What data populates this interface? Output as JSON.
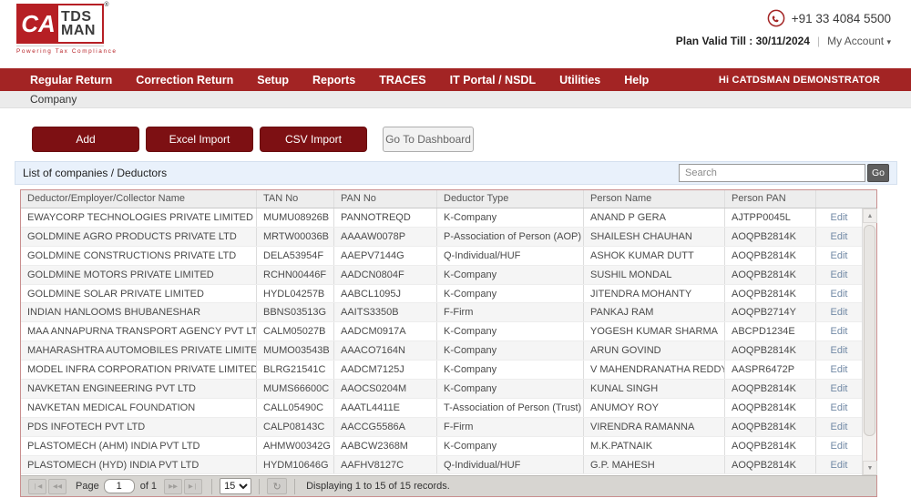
{
  "brand": {
    "ca": "CA",
    "tds": "TDS",
    "man": "MAN",
    "reg": "®",
    "tagline": "Powering Tax Compliance"
  },
  "topbar": {
    "phone": "+91 33 4084 5500",
    "plan_valid": "Plan Valid Till : 30/11/2024",
    "divider": "|",
    "account": "My Account",
    "account_caret": "▾"
  },
  "nav": {
    "items": [
      "Regular Return",
      "Correction Return",
      "Setup",
      "Reports",
      "TRACES",
      "IT Portal / NSDL",
      "Utilities",
      "Help"
    ],
    "greeting": "Hi CATDSMAN DEMONSTRATOR"
  },
  "breadcrumb": {
    "label": "Company"
  },
  "toolbar": {
    "add": "Add",
    "excel": "Excel Import",
    "csv": "CSV Import",
    "dashboard": "Go To Dashboard"
  },
  "panel": {
    "title": "List of companies / Deductors",
    "search_placeholder": "Search",
    "go": "Go"
  },
  "table": {
    "columns": {
      "name": "Deductor/Employer/Collector Name",
      "tan": "TAN No",
      "pan": "PAN No",
      "type": "Deductor Type",
      "person": "Person Name",
      "person_pan": "Person PAN"
    },
    "edit": "Edit",
    "rows": [
      {
        "name": "EWAYCORP TECHNOLOGIES PRIVATE LIMITED",
        "tan": "MUMU08926B",
        "pan": "PANNOTREQD",
        "type": "K-Company",
        "person": "ANAND P GERA",
        "person_pan": "AJTPP0045L"
      },
      {
        "name": "GOLDMINE AGRO PRODUCTS PRIVATE LTD",
        "tan": "MRTW00036B",
        "pan": "AAAAW0078P",
        "type": "P-Association of Person (AOP)",
        "person": "SHAILESH CHAUHAN",
        "person_pan": "AOQPB2814K"
      },
      {
        "name": "GOLDMINE CONSTRUCTIONS PRIVATE LTD",
        "tan": "DELA53954F",
        "pan": "AAEPV7144G",
        "type": "Q-Individual/HUF",
        "person": "ASHOK KUMAR DUTT",
        "person_pan": "AOQPB2814K"
      },
      {
        "name": "GOLDMINE MOTORS PRIVATE LIMITED",
        "tan": "RCHN00446F",
        "pan": "AADCN0804F",
        "type": "K-Company",
        "person": "SUSHIL MONDAL",
        "person_pan": "AOQPB2814K"
      },
      {
        "name": "GOLDMINE SOLAR PRIVATE LIMITED",
        "tan": "HYDL04257B",
        "pan": "AABCL1095J",
        "type": "K-Company",
        "person": "JITENDRA MOHANTY",
        "person_pan": "AOQPB2814K"
      },
      {
        "name": "INDIAN HANLOOMS BHUBANESHAR",
        "tan": "BBNS03513G",
        "pan": "AAITS3350B",
        "type": "F-Firm",
        "person": "PANKAJ RAM",
        "person_pan": "AOQPB2714Y"
      },
      {
        "name": "MAA ANNAPURNA TRANSPORT AGENCY PVT LTD",
        "tan": "CALM05027B",
        "pan": "AADCM0917A",
        "type": "K-Company",
        "person": "YOGESH KUMAR SHARMA",
        "person_pan": "ABCPD1234E"
      },
      {
        "name": "MAHARASHTRA AUTOMOBILES PRIVATE LIMITED",
        "tan": "MUMO03543B",
        "pan": "AAACO7164N",
        "type": "K-Company",
        "person": "ARUN GOVIND",
        "person_pan": "AOQPB2814K"
      },
      {
        "name": "MODEL INFRA CORPORATION PRIVATE LIMITED",
        "tan": "BLRG21541C",
        "pan": "AADCM7125J",
        "type": "K-Company",
        "person": "V MAHENDRANATHA REDDY",
        "person_pan": "AASPR6472P"
      },
      {
        "name": "NAVKETAN ENGINEERING PVT LTD",
        "tan": "MUMS66600C",
        "pan": "AAOCS0204M",
        "type": "K-Company",
        "person": "KUNAL SINGH",
        "person_pan": "AOQPB2814K"
      },
      {
        "name": "NAVKETAN MEDICAL FOUNDATION",
        "tan": "CALL05490C",
        "pan": "AAATL4411E",
        "type": "T-Association of Person (Trust)",
        "person": "ANUMOY ROY",
        "person_pan": "AOQPB2814K"
      },
      {
        "name": "PDS INFOTECH PVT LTD",
        "tan": "CALP08143C",
        "pan": "AACCG5586A",
        "type": "F-Firm",
        "person": "VIRENDRA RAMANNA",
        "person_pan": "AOQPB2814K"
      },
      {
        "name": "PLASTOMECH (AHM) INDIA PVT LTD",
        "tan": "AHMW00342G",
        "pan": "AABCW2368M",
        "type": "K-Company",
        "person": "M.K.PATNAIK",
        "person_pan": "AOQPB2814K"
      },
      {
        "name": "PLASTOMECH (HYD) INDIA PVT LTD",
        "tan": "HYDM10646G",
        "pan": "AAFHV8127C",
        "type": "Q-Individual/HUF",
        "person": "G.P. MAHESH",
        "person_pan": "AOQPB2814K"
      }
    ]
  },
  "pager": {
    "first": "❘◀",
    "prev": "◀◀",
    "next": "▶▶",
    "last": "▶❘",
    "page_label": "Page",
    "page_value": "1",
    "of": "of 1",
    "page_size": "15",
    "refresh": "↻",
    "status": "Displaying 1 to 15 of 15 records."
  },
  "colors": {
    "navbar_red": "#a32424",
    "button_maroon": "#7d1013",
    "brand_red": "#b61f24",
    "panel_blue": "#e9f1fb",
    "table_border": "#c98f8f",
    "edit_link": "#7189a5"
  }
}
